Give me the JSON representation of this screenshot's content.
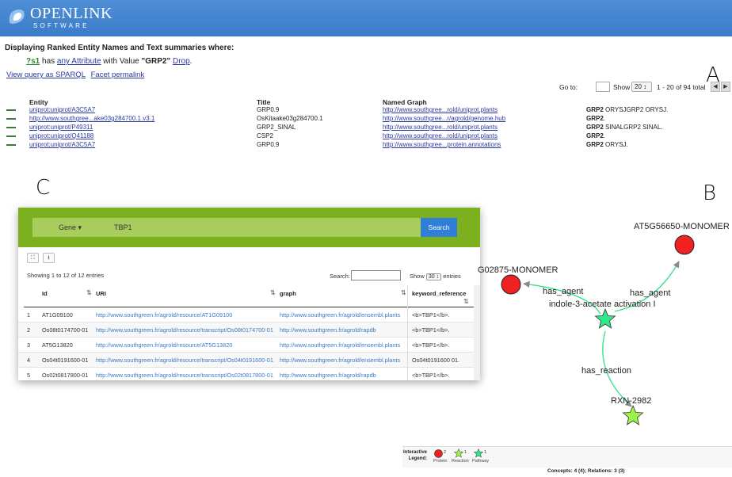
{
  "header": {
    "logo_text": "OPENLINK",
    "logo_sub": "SOFTWARE",
    "brand_color": "#3a7cc9"
  },
  "panel_labels": {
    "a": "A",
    "b": "B",
    "c": "C"
  },
  "query": {
    "title": "Displaying Ranked Entity Names and Text summaries where:",
    "subject_var": "?s1",
    "has_text": "has",
    "attribute_link": "any Attribute",
    "with_value_text": "with Value",
    "value": "\"GRP2\"",
    "drop_link": "Drop",
    "view_sparql_link": "View query as SPARQL",
    "facet_permalink": "Facet permalink"
  },
  "pager": {
    "goto_label": "Go to:",
    "show_label": "Show",
    "show_value": "20 ↕",
    "range_text": "1 - 20 of 94 total",
    "prev_icon": "◀",
    "next_icon": "▶"
  },
  "results": {
    "columns": {
      "entity": "Entity",
      "title": "Title",
      "graph": "Named Graph",
      "summary": ""
    },
    "rows": [
      {
        "entity": "uniprot:uniprot/A3C5A7",
        "title": "GRP0.9",
        "graph": "http://www.southgree...rold/uniprot.plants",
        "summary_bold": "GRP2",
        "summary_rest": " ORYSJGRP2 ORYSJ."
      },
      {
        "entity": "http://www.southgree...ake03g284700.1.v3.1",
        "title": "OsKitaake03g284700.1",
        "graph": "http://www.southgree...r/agrold/genome.hub",
        "summary_bold": "GRP2",
        "summary_rest": "."
      },
      {
        "entity": "uniprot:uniprot/P49311",
        "title": "GRP2_SINAL",
        "graph": "http://www.southgree...rold/uniprot.plants",
        "summary_bold": "GRP2",
        "summary_rest": " SINALGRP2 SINAL."
      },
      {
        "entity": "uniprot:uniprot/Q41188",
        "title": "CSP2",
        "graph": "http://www.southgree...rold/uniprot.plants",
        "summary_bold": "GRP2",
        "summary_rest": "."
      },
      {
        "entity": "uniprot:uniprot/A3C5A7",
        "title": "GRP0.9",
        "graph": "http://www.southgree...protein.annotations",
        "summary_bold": "GRP2",
        "summary_rest": " ORYSJ."
      }
    ]
  },
  "panel_c": {
    "search_type": "Gene ▾",
    "search_value": "TBP1",
    "search_button": "Search",
    "expand_icon": "⛶",
    "download_icon": "⭳",
    "info": "Showing 1 to 12 of 12 entries",
    "search_label": "Search:",
    "show_label": "Show",
    "show_value": "30 ↕",
    "entries_label": "entries",
    "columns": {
      "id": "Id",
      "uri": "URI",
      "graph": "graph",
      "keyword": "keyword_reference"
    },
    "sort_icon": "⇅",
    "rows": [
      {
        "n": "1",
        "id": "AT1G09100",
        "uri": "http://www.southgreen.fr/agrold/resource/AT1G09100",
        "graph": "http://www.southgreen.fr/agrold/ensembl.plants",
        "kw": "<b>TBP1</b>."
      },
      {
        "n": "2",
        "id": "Os08t0174700-01",
        "uri": "http://www.southgreen.fr/agrold/resource/transcript/Os08t0174700-01",
        "graph": "http://www.southgreen.fr/agrold/rapdb",
        "kw": "<b>TBP1</b>."
      },
      {
        "n": "3",
        "id": "AT5G13820",
        "uri": "http://www.southgreen.fr/agrold/resource/AT5G13820",
        "graph": "http://www.southgreen.fr/agrold/ensembl.plants",
        "kw": "<b>TBP1</b>."
      },
      {
        "n": "4",
        "id": "Os04t0191600-01",
        "uri": "http://www.southgreen.fr/agrold/resource/transcript/Os04t0191600-01",
        "graph": "http://www.southgreen.fr/agrold/ensembl.plants",
        "kw": "Os04t0191600 01."
      },
      {
        "n": "5",
        "id": "Os02t0817800-01",
        "uri": "http://www.southgreen.fr/agrold/resource/transcript/Os02t0817800-01",
        "graph": "http://www.southgreen.fr/agrold/rapdb",
        "kw": "<b>TBP1</b>."
      }
    ]
  },
  "graph": {
    "nodes": {
      "protein_right": "AT5G56650-MONOMER",
      "protein_left": "G02875-MONOMER",
      "pathway": "indole-3-acetate activation I",
      "reaction": "RXN-2982"
    },
    "edges": {
      "left_agent": "has_agent",
      "right_agent": "has_agent",
      "reaction": "has_reaction"
    },
    "colors": {
      "protein": "#ee2222",
      "reaction": "#9cf24a",
      "pathway": "#2ee88a",
      "edge": "#3de38e"
    }
  },
  "legend": {
    "title": "Interactive Legend:",
    "protein_count": "2",
    "reaction_count": "1",
    "pathway_count": "1",
    "protein_label": "Protein",
    "reaction_label": "Reaction",
    "pathway_label": "Pathway",
    "concepts_text": "Concepts: 4 (4); Relations: 3 (3)"
  }
}
